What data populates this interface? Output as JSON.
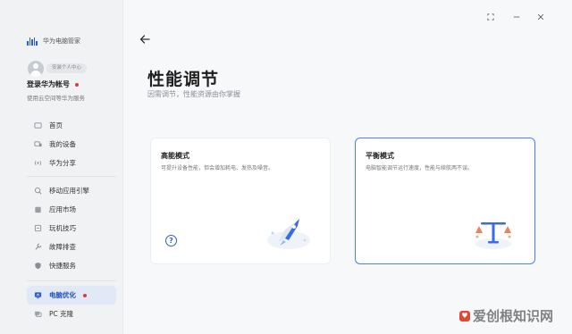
{
  "app": {
    "name": "华为电脑管家"
  },
  "account": {
    "badge": "安装个人中心",
    "login_title": "登录华为帐号",
    "login_sub": "使用云空间等华为服务"
  },
  "nav": {
    "group1": [
      {
        "label": "首页",
        "icon": "home-icon"
      },
      {
        "label": "我的设备",
        "icon": "devices-icon"
      },
      {
        "label": "华为分享",
        "icon": "share-icon"
      }
    ],
    "group2": [
      {
        "label": "移动应用引擎",
        "icon": "engine-icon"
      },
      {
        "label": "应用市场",
        "icon": "store-icon"
      },
      {
        "label": "玩机技巧",
        "icon": "tips-icon"
      },
      {
        "label": "故障排查",
        "icon": "wrench-icon"
      },
      {
        "label": "快捷服务",
        "icon": "shield-icon"
      }
    ],
    "group3": [
      {
        "label": "电脑优化",
        "icon": "optimize-icon",
        "active": true
      },
      {
        "label": "PC 克隆",
        "icon": "clone-icon"
      }
    ]
  },
  "page": {
    "title": "性能调节",
    "subtitle": "因需调节，性能资源由你掌握"
  },
  "cards": [
    {
      "title": "高能模式",
      "desc": "可提升设备性能，但会增加耗电、发热及噪音。",
      "selected": false
    },
    {
      "title": "平衡模式",
      "desc": "电脑智能调节运行速度，性能与续航两不误。",
      "selected": true
    }
  ],
  "watermark": {
    "text": "爱创根知识网"
  },
  "colors": {
    "accent": "#2f5cd6",
    "selected_border": "#4d7ff0",
    "alert_dot": "#e5373b"
  }
}
